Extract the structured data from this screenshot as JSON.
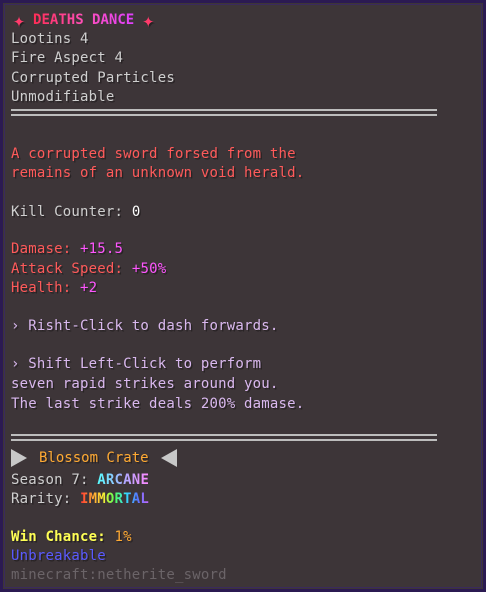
{
  "item": {
    "title_star_left": "✦",
    "title": "DEATHS DANCE",
    "title_star_right": "✦",
    "enchantments": [
      "Lootins 4",
      "Fire Aspect 4",
      "Corrupted Particles",
      "Unmodifiable"
    ],
    "lore": [
      "A corrupted sword forsed from the",
      "remains of an unknown void herald."
    ],
    "kill_counter_label": "Kill Counter: ",
    "kill_counter_value": "0",
    "stats": {
      "damage_label": "Damase: ",
      "damage_value": "+15.5",
      "attack_speed_label": "Attack Speed: ",
      "attack_speed_value": "+50%",
      "health_label": "Health: ",
      "health_value": "+2"
    },
    "abilities": [
      "› Risht-Click to dash forwards.",
      "› Shift Left-Click to perform",
      "seven rapid strikes around you.",
      "The last strike deals 200% damase."
    ],
    "crate": "Blossom Crate",
    "season_label": "Season 7: ",
    "season_value": "ARCANE",
    "rarity_label": "Rarity: ",
    "rarity_value": "IMMORTAL",
    "win_chance_label": "Win Chance: ",
    "win_chance_value": "1%",
    "unbreakable": "Unbreakable",
    "item_id": "minecraft:netherite_sword"
  },
  "colors": {
    "background": "#3d3538",
    "border": "#2b1a52",
    "title": "#ff3b6b",
    "lore": "#ff5a5a",
    "stat_label": "#ff5a5a",
    "stat_value": "#ff55ff",
    "ability": "#d9b8ee",
    "crate": "#ffaa33",
    "win_chance": "#ffff55",
    "unbreakable": "#5a5aff",
    "item_id": "#6b6468"
  }
}
